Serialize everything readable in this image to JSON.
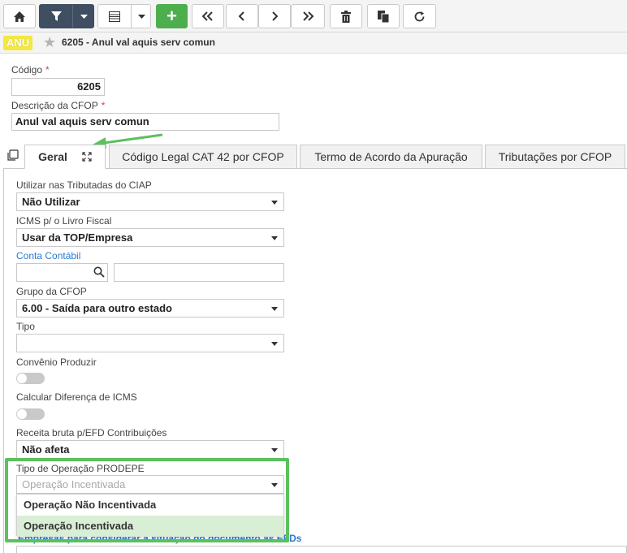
{
  "colors": {
    "toolbar_dark": "#3f4e60",
    "add_green": "#4cae4c",
    "badge_yellow": "#f3e842",
    "highlight_green": "#5cc05c",
    "link_blue": "#2a7bd3",
    "required_red": "#e0403a"
  },
  "toolbar": {
    "icons": [
      "home-icon",
      "filter-icon",
      "chevron-down-icon",
      "grid-icon",
      "chevron-down-icon",
      "plus-icon",
      "first-page-icon",
      "prev-icon",
      "next-icon",
      "last-page-icon",
      "trash-icon",
      "copy-icon",
      "refresh-icon"
    ],
    "add_label": "+"
  },
  "header": {
    "badge": "ANU",
    "title": "6205 - Anul val aquis serv comun"
  },
  "form": {
    "codigo_label": "Código",
    "codigo_value": "6205",
    "descricao_label": "Descrição da CFOP",
    "descricao_value": "Anul val aquis serv comun",
    "required_mark": "*"
  },
  "tabs": [
    {
      "label": "Geral"
    },
    {
      "label": "Código Legal CAT 42 por CFOP"
    },
    {
      "label": "Termo de Acordo da Apuração"
    },
    {
      "label": "Tributações por CFOP"
    }
  ],
  "fields": {
    "ciap_label": "Utilizar nas Tributadas do CIAP",
    "ciap_value": "Não Utilizar",
    "icms_livro_label": "ICMS p/ o Livro Fiscal",
    "icms_livro_value": "Usar da TOP/Empresa",
    "conta_label": "Conta Contábil",
    "grupo_label": "Grupo da CFOP",
    "grupo_value": "6.00 - Saída para outro estado",
    "tipo_label": "Tipo",
    "tipo_value": "",
    "convenio_label": "Convênio Produzir",
    "calc_icms_label": "Calcular Diferença de ICMS",
    "receita_label": "Receita bruta p/EFD Contribuições",
    "receita_value": "Não afeta",
    "prodepe_label": "Tipo de Operação PRODEPE",
    "prodepe_placeholder": "Operação Incentivada",
    "prodepe_options": [
      "Operação Não Incentivada",
      "Operação Incentivada"
    ],
    "empresas_link": "Empresas para considerar a situação do documento  as EFDs"
  }
}
